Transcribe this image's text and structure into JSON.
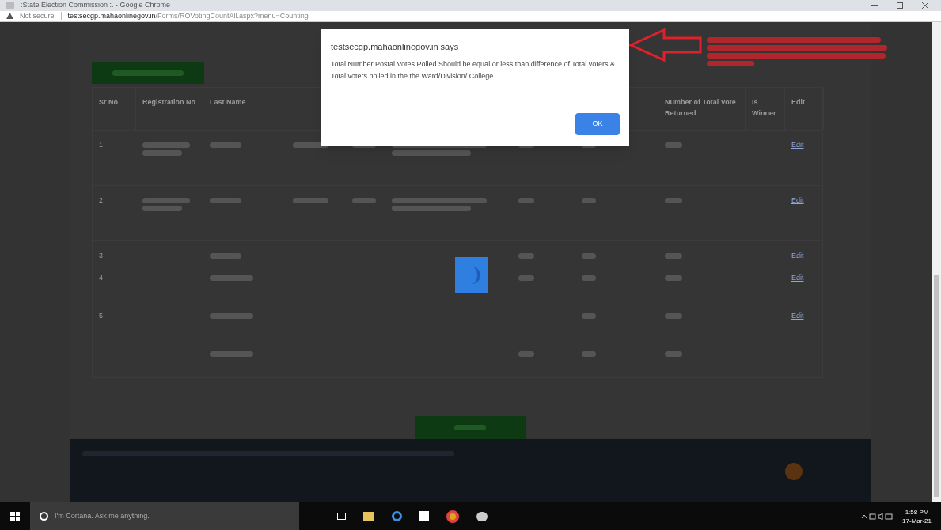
{
  "window": {
    "title": ":State Election Commission :. - Google Chrome"
  },
  "address_bar": {
    "security": "Not secure",
    "url_host": "testsecgp.mahaonlinegov.in",
    "url_path": "/Forms/ROVotingCountAll.aspx?menu=Counting"
  },
  "table": {
    "columns": [
      "Sr No",
      "Registration No",
      "Last Name",
      "",
      "",
      "",
      "",
      "",
      "Number of Total Vote Returned",
      "Is Winner",
      "Edit"
    ],
    "rows": [
      {
        "sr": "1",
        "edit": "Edit"
      },
      {
        "sr": "2",
        "edit": "Edit"
      },
      {
        "sr": "3",
        "edit": "Edit"
      },
      {
        "sr": "4",
        "edit": "Edit"
      },
      {
        "sr": "5",
        "edit": "Edit"
      },
      {
        "sr": "",
        "edit": ""
      }
    ]
  },
  "dialog": {
    "origin": "testsecgp.mahaonlinegov.in says",
    "message": "Total Number Postal Votes Polled Should be equal or less than difference of Total voters & Total voters polled in the the Ward/Division/ College",
    "ok": "OK"
  },
  "taskbar": {
    "search_placeholder": "I'm Cortana. Ask me anything.",
    "time": "1:58 PM",
    "date": "17-Mar-21"
  }
}
